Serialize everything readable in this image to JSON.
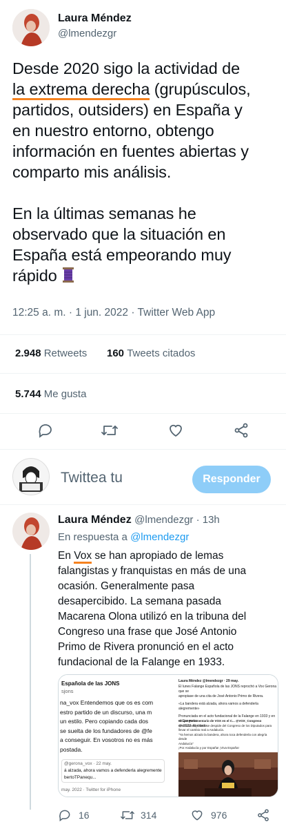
{
  "main_tweet": {
    "author_name": "Laura Méndez",
    "author_handle": "@lmendezgr",
    "text_lines": [
      "Desde 2020 sigo la actividad de",
      "la extrema derecha (grupúsculos,",
      "partidos, outsiders) en España y",
      "en nuestro entorno, obtengo",
      "información en fuentes abiertas y",
      "comparto mis análisis."
    ],
    "text_lines_2": [
      "En la últimas semanas he",
      "observado que la situación en",
      "España está empeorando muy",
      "rápido"
    ],
    "emoji": "🧵",
    "timestamp": "12:25 a. m. · 1 jun. 2022 · Twitter Web App",
    "retweets_count": "2.948",
    "retweets_label": "Retweets",
    "quotes_count": "160",
    "quotes_label": "Tweets citados",
    "likes_count": "5.744",
    "likes_label": "Me gusta"
  },
  "compose": {
    "placeholder": "Twittea tu",
    "reply_label": "Responder"
  },
  "reply_tweet": {
    "author_name": "Laura Méndez",
    "author_handle": "@lmendezgr",
    "time": "13h",
    "replying_to_prefix": "En respuesta a",
    "replying_to_handle": "@lmendezgr",
    "text_lines": [
      "En Vox se han apropiado de lemas",
      "falangistas y franquistas en más de una",
      "ocasión. Generalmente pasa",
      "desapercibido. La semana pasada",
      "Macarena Olona utilizó en la tribuna del",
      "Congreso una frase que José Antonio",
      "Primo de Rivera pronunció en el acto",
      "fundacional de la Falange en 1933."
    ],
    "reply_count": "16",
    "retweet_count": "314",
    "like_count": "976"
  },
  "embedded_left": {
    "header": "Española de las JONS",
    "sub": "sjons",
    "lines": [
      "na_vox Entendemos que os es com",
      "estro partido de un discurso, una m",
      "un estilo. Pero copiando cada dos",
      "se suelta de los fundadores de @fe",
      "a conseguir. En vosotros no es más",
      "postada."
    ],
    "quote_handle": "@gerona_vox · 22 may.",
    "quote_line1": "á alzada, ahora vamos a defenderla alegremente",
    "quote_line2": "bertoTPanequ...",
    "footer": "may. 2022 · Twitter for iPhone"
  },
  "embedded_right": {
    "header": "Laura Méndez @lmendezgr · 29 may.",
    "lines": [
      "El lunes Falange Española de las JONS reprochó a Vox Gerona que se",
      "apropiase de una cita de José Antonio Primo de Rivera.",
      "«La bandera está alzada, ahora vamos a defenderla alegremente»",
      "Pronunciada en el acto fundacional de la Falange en 1933 y en el Congreso",
      "en 2022. Atentado."
    ],
    "quote_header": "Grupo Parlamentario de VOX en el C... @VOX_Congreso",
    "quote_lines": [
      "@Macarena_Olona se despide del Congreso de los Diputados para",
      "llevar el cambio real a Andalucía.",
      "\"Ya hemos alzado la bandera, ahora toca defenderla con alegría desde",
      "Andalucía\"",
      "¡Por Andalucía y por España! ¡Viva España!"
    ]
  }
}
